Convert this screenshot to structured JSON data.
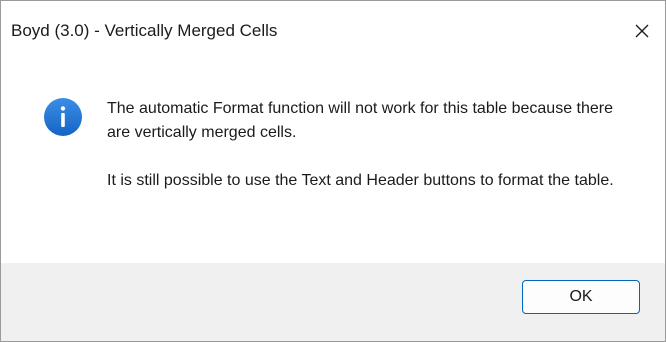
{
  "window": {
    "title": "Boyd (3.0) - Vertically Merged Cells"
  },
  "dialog": {
    "icon": "info-icon",
    "message_line_1": "The automatic Format function will not work for this table because there are vertically merged cells.",
    "message_line_2": "It is still possible to use the Text and Header buttons to format the table."
  },
  "buttons": {
    "ok_label": "OK",
    "close_icon": "close-icon"
  },
  "colors": {
    "accent": "#0067c0",
    "info_icon": "#1e6fd3",
    "footer_bg": "#f0f0f0"
  }
}
